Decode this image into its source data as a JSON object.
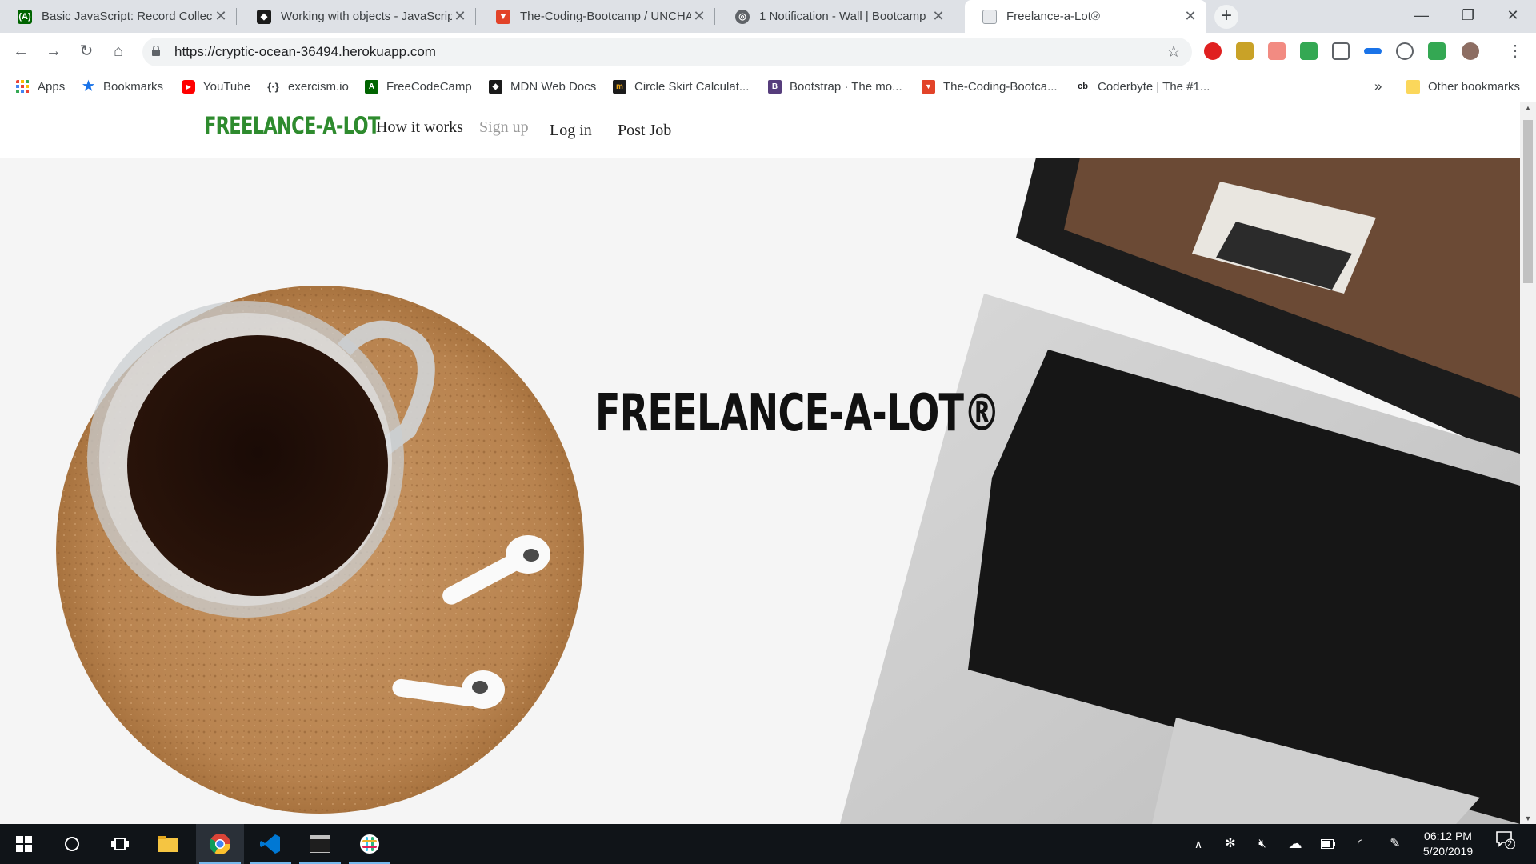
{
  "browser": {
    "tabs": [
      {
        "title": "Basic JavaScript: Record Collectic",
        "favicon": "freecodecamp-icon",
        "color": "#006400"
      },
      {
        "title": "Working with objects - JavaScript",
        "favicon": "mdn-icon",
        "color": "#1b1b1b"
      },
      {
        "title": "The-Coding-Bootcamp / UNCHA",
        "favicon": "gitlab-icon",
        "color": "#e24329"
      },
      {
        "title": "1 Notification - Wall | Bootcamp",
        "favicon": "globe-icon",
        "color": "#5f6368"
      },
      {
        "title": "Freelance-a-Lot®",
        "favicon": "page-icon",
        "color": "#9aa0a6"
      }
    ],
    "url": "https://cryptic-ocean-36494.herokuapp.com",
    "bookmarks": [
      {
        "label": "Apps",
        "icon": "apps-grid-icon",
        "color": "#ea4335"
      },
      {
        "label": "Bookmarks",
        "icon": "star-icon",
        "color": "#1a73e8"
      },
      {
        "label": "YouTube",
        "icon": "youtube-icon",
        "color": "#ff0000"
      },
      {
        "label": "exercism.io",
        "icon": "exercism-icon",
        "color": "#3c4043"
      },
      {
        "label": "FreeCodeCamp",
        "icon": "freecodecamp-icon",
        "color": "#006400"
      },
      {
        "label": "MDN Web Docs",
        "icon": "mdn-icon",
        "color": "#1b1b1b"
      },
      {
        "label": "Circle Skirt Calculat...",
        "icon": "m-icon",
        "color": "#e8a317"
      },
      {
        "label": "Bootstrap · The mo...",
        "icon": "bootstrap-icon",
        "color": "#563d7c"
      },
      {
        "label": "The-Coding-Bootca...",
        "icon": "gitlab-icon",
        "color": "#e24329"
      },
      {
        "label": "Coderbyte | The #1...",
        "icon": "coderbyte-icon",
        "color": "#202124"
      }
    ],
    "overflow_label": "»",
    "other_bookmarks": "Other bookmarks"
  },
  "site": {
    "brand": "FREELANCE-A-LOT",
    "nav": {
      "how": "How it works",
      "signup": "Sign up",
      "login": "Log in",
      "post": "Post Job"
    },
    "hero_title": "FREELANCE-A-LOT®"
  },
  "taskbar": {
    "time": "06:12 PM",
    "date": "5/20/2019",
    "notifications": "2"
  }
}
